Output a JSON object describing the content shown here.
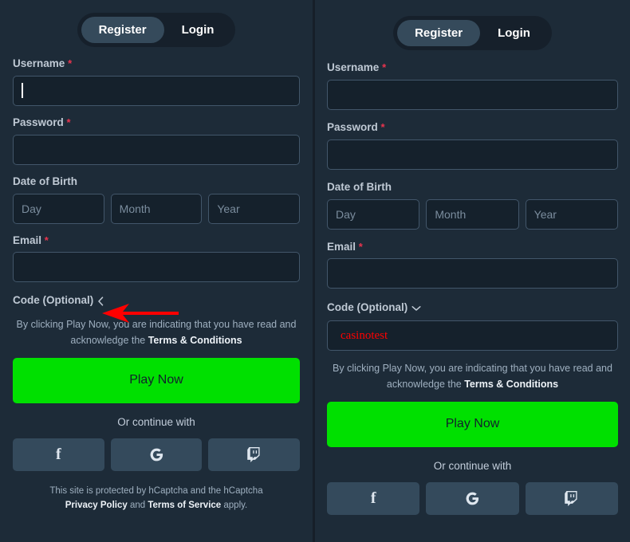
{
  "tabs": {
    "register": "Register",
    "login": "Login",
    "active": "Register"
  },
  "form": {
    "username_label": "Username",
    "password_label": "Password",
    "dob_label": "Date of Birth",
    "email_label": "Email",
    "required_mark": "*",
    "dob_day_placeholder": "Day",
    "dob_month_placeholder": "Month",
    "dob_year_placeholder": "Year",
    "username_value": "",
    "password_value": "",
    "email_value": ""
  },
  "code_section": {
    "label": "Code (Optional)",
    "collapsed_chevron": "chevron-left",
    "expanded_chevron": "chevron-down",
    "value": "casinotest",
    "value_color": "#ff0000"
  },
  "terms": {
    "line1": "By clicking Play Now, you are indicating that you have read and",
    "line2_prefix": "acknowledge the ",
    "line2_link": "Terms & Conditions"
  },
  "play_button": {
    "label": "Play Now",
    "color": "#00e000"
  },
  "social": {
    "continue_label": "Or continue with",
    "providers": [
      {
        "name": "facebook",
        "glyph": "f"
      },
      {
        "name": "google",
        "glyph": "G"
      },
      {
        "name": "twitch",
        "glyph": "twitch"
      }
    ]
  },
  "captcha": {
    "line1": "This site is protected by hCaptcha and the hCaptcha",
    "privacy_policy": "Privacy Policy",
    "and": " and ",
    "terms_of_service": "Terms of Service",
    "suffix": " apply."
  },
  "annotation": {
    "type": "arrow",
    "direction": "left",
    "color": "#ff0000",
    "points_to": "Code (Optional) toggle"
  },
  "theme": {
    "background": "#1d2b38",
    "input_background": "#15212c",
    "input_border": "#42566a",
    "accent_green": "#00e000",
    "required_red": "#e8344e",
    "social_button": "#344a5c"
  }
}
